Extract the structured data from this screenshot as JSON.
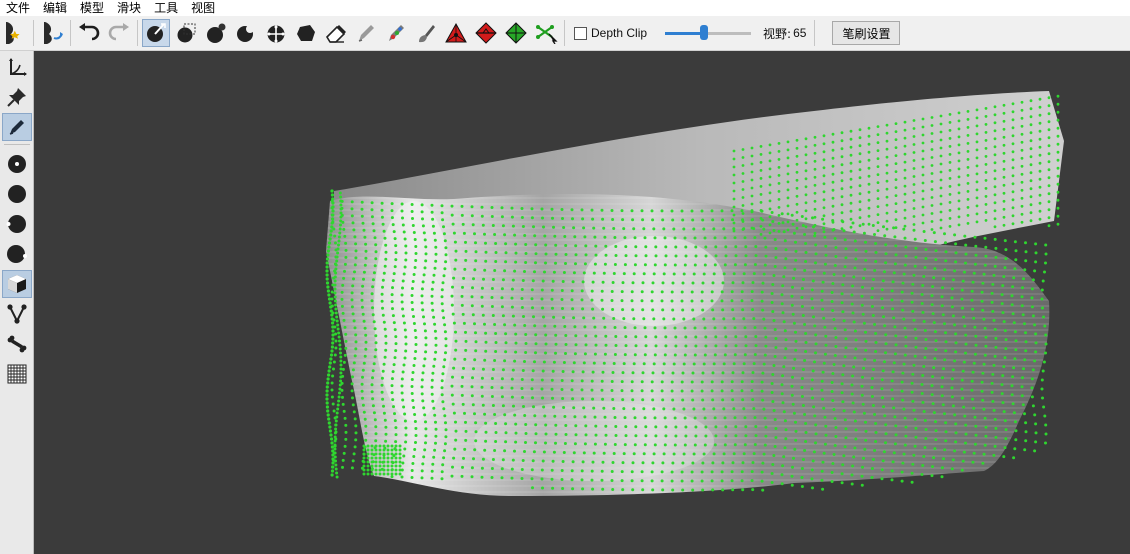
{
  "menu": [
    "文件",
    "编辑",
    "模型",
    "滑块",
    "工具",
    "视图"
  ],
  "toolbar": {
    "tools": [
      "model-mirror-icon",
      "model-flip-icon",
      "undo-icon",
      "redo-icon",
      "brush-select-icon",
      "rect-select-icon",
      "sphere-add-icon",
      "sphere-sub-icon",
      "move-points-icon",
      "smooth-points-icon",
      "eraser-icon",
      "pen-icon",
      "color-pen-icon",
      "paint-brush-icon",
      "red-triangle-icon",
      "red-diamond-icon",
      "green-diamond-icon",
      "link-points-icon"
    ],
    "depth_clip_label": "Depth Clip",
    "depth_clip_checked": false,
    "fov_label": "视野:",
    "fov_value": "65",
    "fov_slider_fraction": 0.45,
    "brush_settings_label": "笔刷设置"
  },
  "sidebar": {
    "tools": [
      "axis-icon",
      "pin-icon",
      "pencil-icon",
      "vertex-dot-icon",
      "sphere-icon",
      "sphere-left-icon",
      "sphere-right-icon",
      "cube-icon",
      "edge-vertices-icon",
      "bone-icon",
      "grid-icon"
    ],
    "active_tool": "pencil-icon"
  },
  "viewport": {
    "point_color": "#2fd62f",
    "mesh_color": "#9a9a9a",
    "background": "#3b3b3b"
  }
}
